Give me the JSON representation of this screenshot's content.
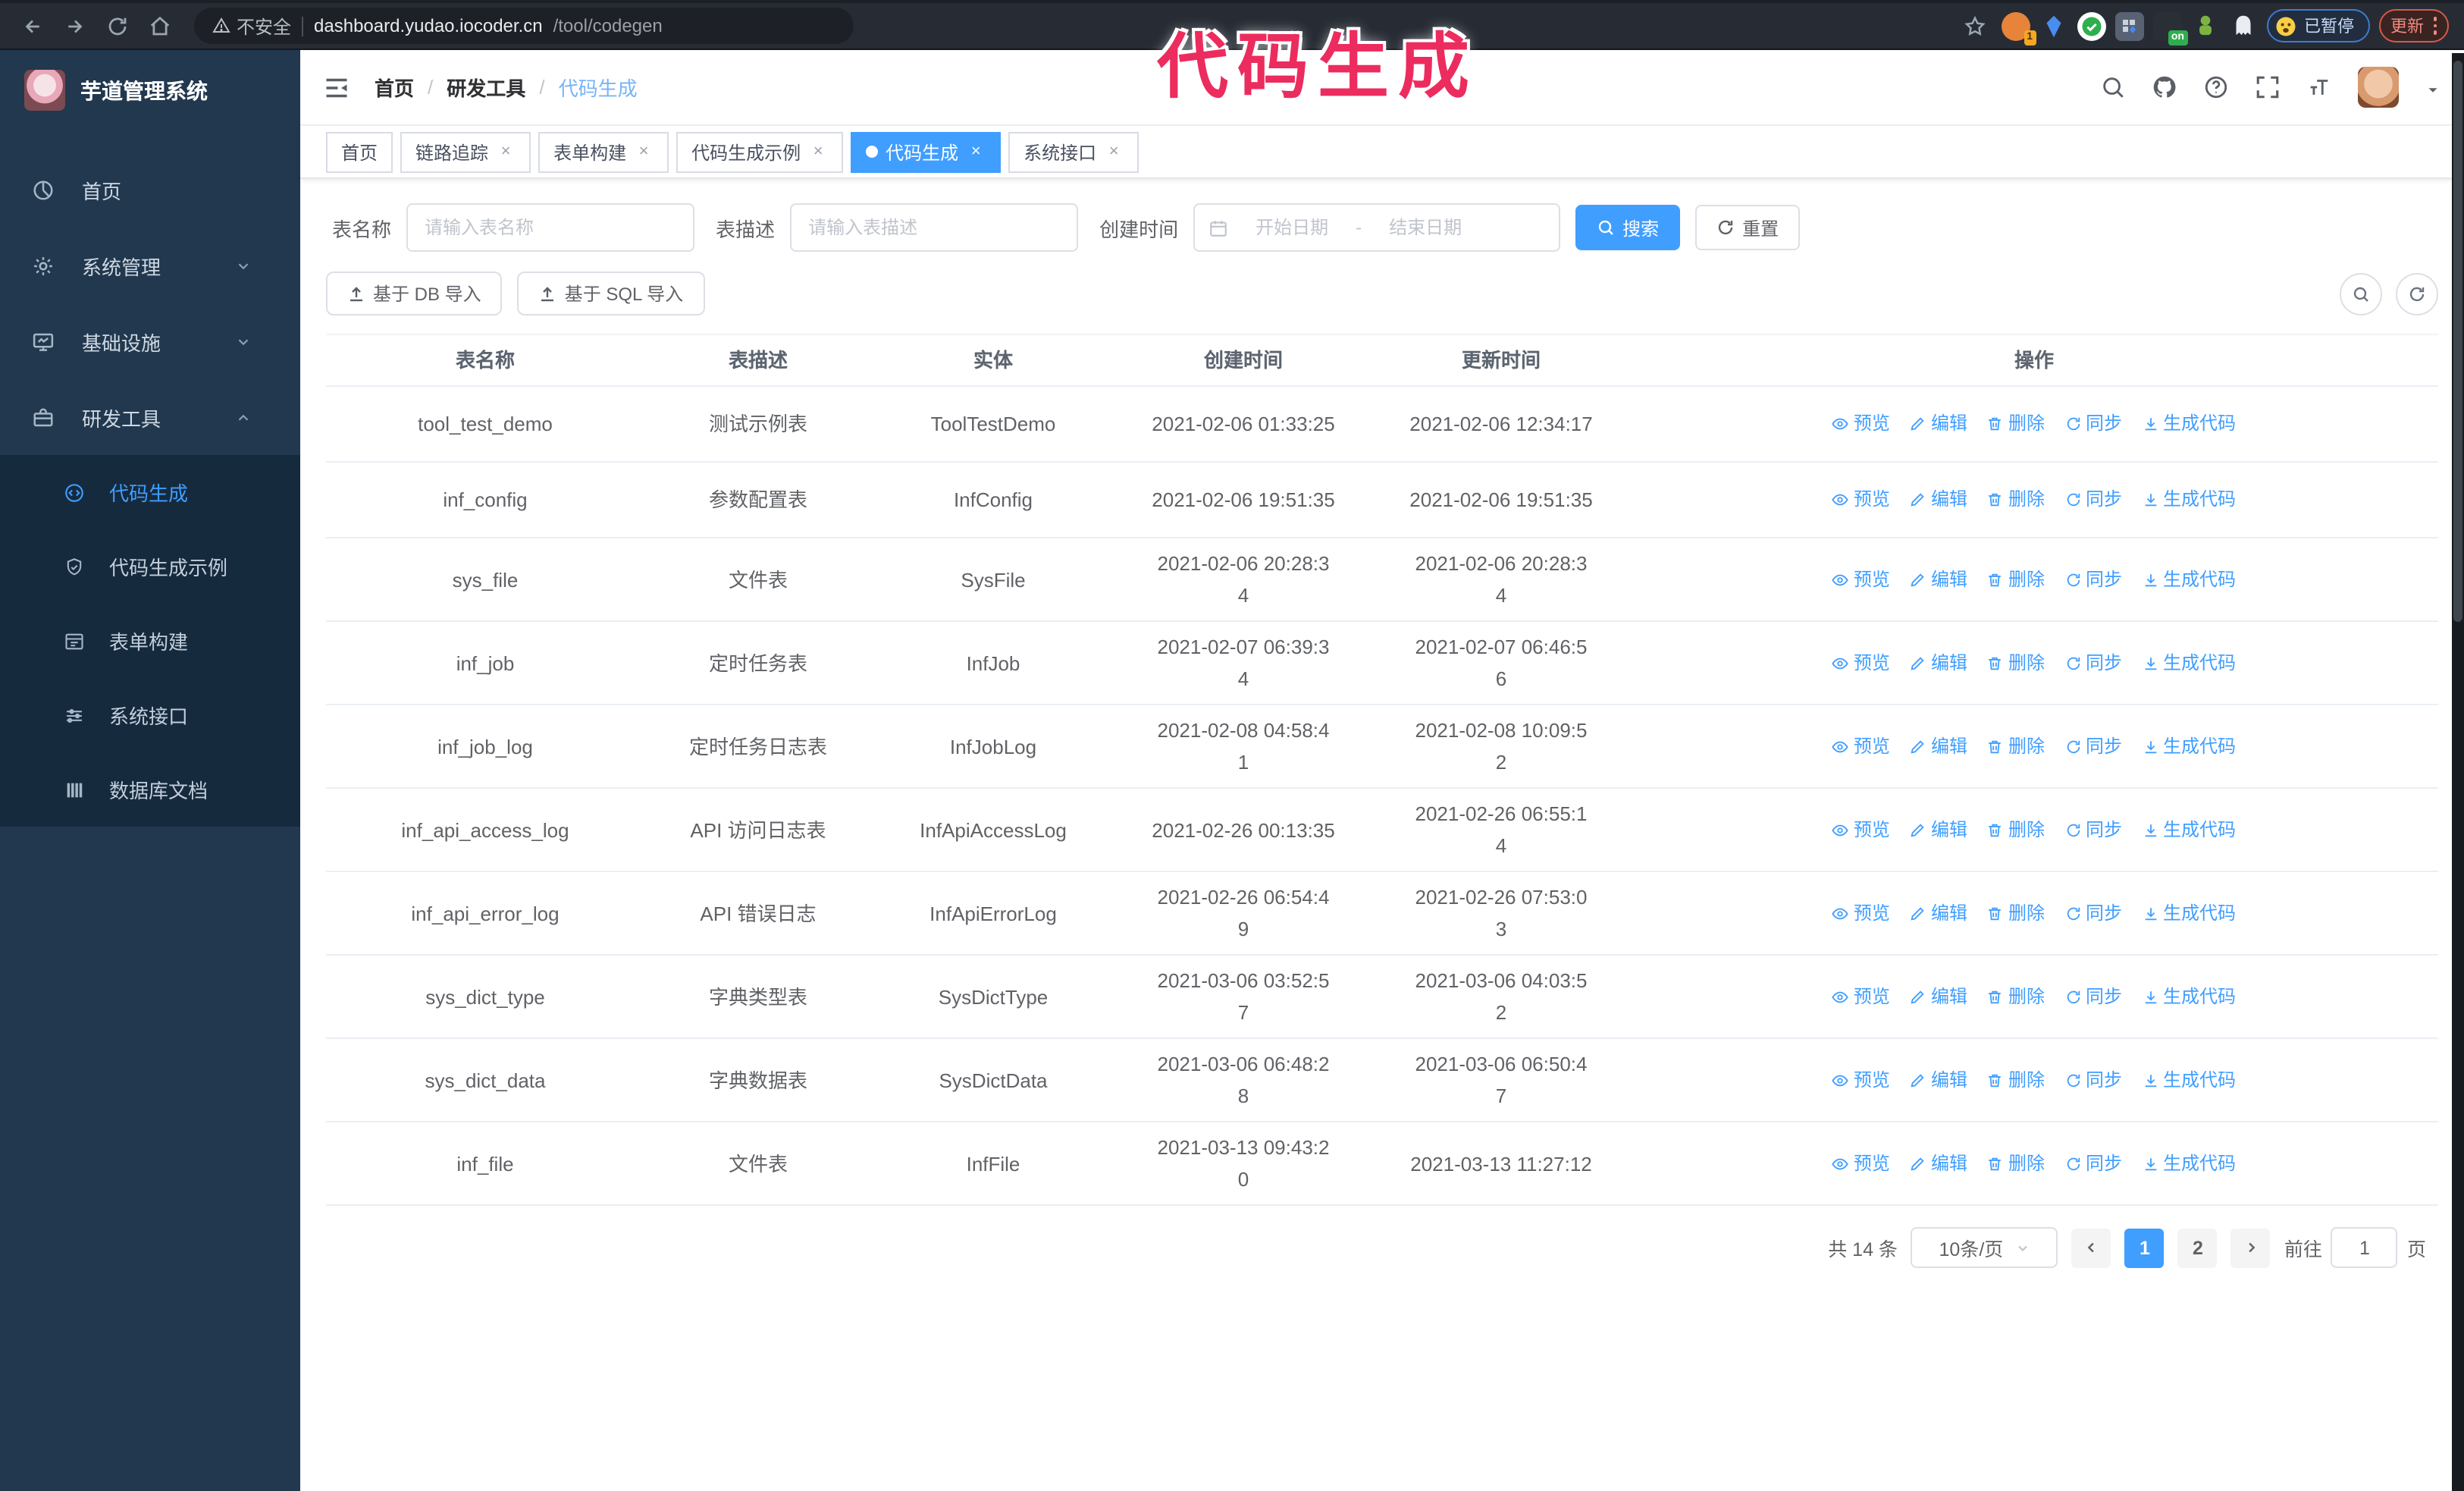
{
  "browser": {
    "security_label": "不安全",
    "url_host": "dashboard.yudao.iocoder.cn",
    "url_path": "/tool/codegen",
    "ext_badge_1": "1",
    "ext_badge_on": "on",
    "paused_badge": "已暂停",
    "update_button": "更新"
  },
  "annotation": {
    "text": "代码生成",
    "color": "#ec2c5e"
  },
  "sidebar": {
    "title": "芋道管理系统",
    "items": [
      {
        "label": "首页",
        "icon": "dashboard-icon",
        "arrow": ""
      },
      {
        "label": "系统管理",
        "icon": "gear-icon",
        "arrow": "down"
      },
      {
        "label": "基础设施",
        "icon": "monitor-icon",
        "arrow": "down"
      },
      {
        "label": "研发工具",
        "icon": "toolbox-icon",
        "arrow": "up"
      }
    ],
    "submenu": [
      {
        "label": "代码生成",
        "icon": "code-icon",
        "active": true
      },
      {
        "label": "代码生成示例",
        "icon": "shield-check-icon",
        "active": false
      },
      {
        "label": "表单构建",
        "icon": "form-icon",
        "active": false
      },
      {
        "label": "系统接口",
        "icon": "sliders-icon",
        "active": false
      },
      {
        "label": "数据库文档",
        "icon": "database-icon",
        "active": false
      }
    ]
  },
  "navbar": {
    "breadcrumb": [
      "首页",
      "研发工具",
      "代码生成"
    ],
    "separator": "/"
  },
  "tags": [
    {
      "label": "首页",
      "closable": false,
      "active": false
    },
    {
      "label": "链路追踪",
      "closable": true,
      "active": false
    },
    {
      "label": "表单构建",
      "closable": true,
      "active": false
    },
    {
      "label": "代码生成示例",
      "closable": true,
      "active": false
    },
    {
      "label": "代码生成",
      "closable": true,
      "active": true
    },
    {
      "label": "系统接口",
      "closable": true,
      "active": false
    }
  ],
  "search": {
    "name_label": "表名称",
    "name_placeholder": "请输入表名称",
    "desc_label": "表描述",
    "desc_placeholder": "请输入表描述",
    "time_label": "创建时间",
    "start_placeholder": "开始日期",
    "range_separator": "-",
    "end_placeholder": "结束日期",
    "search_label": "搜索",
    "reset_label": "重置"
  },
  "toolbar": {
    "db_import_label": "基于 DB 导入",
    "sql_import_label": "基于 SQL 导入"
  },
  "table": {
    "headers": [
      "表名称",
      "表描述",
      "实体",
      "创建时间",
      "更新时间",
      "操作"
    ],
    "actions": [
      {
        "label": "预览",
        "icon": "eye-icon"
      },
      {
        "label": "编辑",
        "icon": "edit-icon"
      },
      {
        "label": "删除",
        "icon": "delete-icon"
      },
      {
        "label": "同步",
        "icon": "sync-icon"
      },
      {
        "label": "生成代码",
        "icon": "download-icon"
      }
    ],
    "rows": [
      {
        "name": "tool_test_demo",
        "desc": "测试示例表",
        "entity": "ToolTestDemo",
        "created": "2021-02-06 01:33:25",
        "updated": "2021-02-06 12:34:17"
      },
      {
        "name": "inf_config",
        "desc": "参数配置表",
        "entity": "InfConfig",
        "created": "2021-02-06 19:51:35",
        "updated": "2021-02-06 19:51:35"
      },
      {
        "name": "sys_file",
        "desc": "文件表",
        "entity": "SysFile",
        "created": "2021-02-06 20:28:3\n4",
        "updated": "2021-02-06 20:28:3\n4"
      },
      {
        "name": "inf_job",
        "desc": "定时任务表",
        "entity": "InfJob",
        "created": "2021-02-07 06:39:3\n4",
        "updated": "2021-02-07 06:46:5\n6"
      },
      {
        "name": "inf_job_log",
        "desc": "定时任务日志表",
        "entity": "InfJobLog",
        "created": "2021-02-08 04:58:4\n1",
        "updated": "2021-02-08 10:09:5\n2"
      },
      {
        "name": "inf_api_access_log",
        "desc": "API 访问日志表",
        "entity": "InfApiAccessLog",
        "created": "2021-02-26 00:13:35",
        "updated": "2021-02-26 06:55:1\n4"
      },
      {
        "name": "inf_api_error_log",
        "desc": "API 错误日志",
        "entity": "InfApiErrorLog",
        "created": "2021-02-26 06:54:4\n9",
        "updated": "2021-02-26 07:53:0\n3"
      },
      {
        "name": "sys_dict_type",
        "desc": "字典类型表",
        "entity": "SysDictType",
        "created": "2021-03-06 03:52:5\n7",
        "updated": "2021-03-06 04:03:5\n2"
      },
      {
        "name": "sys_dict_data",
        "desc": "字典数据表",
        "entity": "SysDictData",
        "created": "2021-03-06 06:48:2\n8",
        "updated": "2021-03-06 06:50:4\n7"
      },
      {
        "name": "inf_file",
        "desc": "文件表",
        "entity": "InfFile",
        "created": "2021-03-13 09:43:2\n0",
        "updated": "2021-03-13 11:27:12"
      }
    ]
  },
  "pagination": {
    "total": "共 14 条",
    "page_size": "10条/页",
    "pages": [
      "1",
      "2"
    ],
    "active_page": "1",
    "goto_label": "前往",
    "goto_value": "1",
    "goto_suffix": "页"
  },
  "colors": {
    "primary": "#409eff",
    "annotation": "#ec2c5e",
    "sidebar_bg": "#22384e",
    "submenu_bg": "#162a3e"
  }
}
